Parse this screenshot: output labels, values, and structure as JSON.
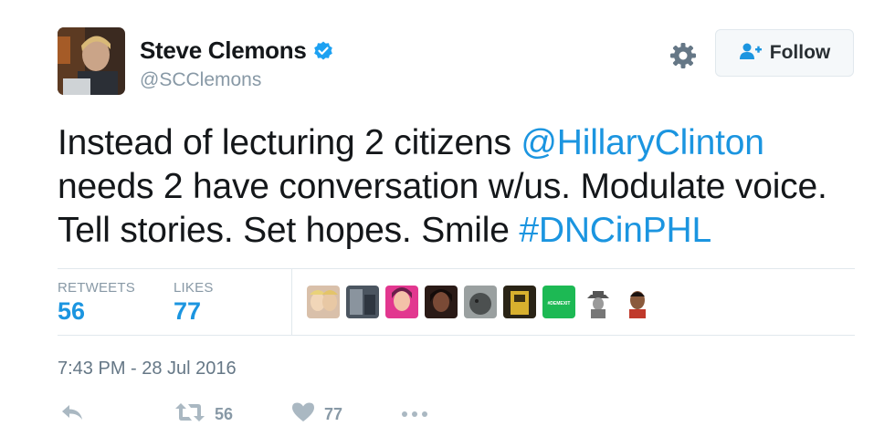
{
  "author": {
    "name": "Steve Clemons",
    "handle": "@SCClemons",
    "verified": true
  },
  "follow_button": {
    "label": "Follow"
  },
  "tweet": {
    "text_before_mention": "Instead of lecturing 2 citizens ",
    "mention": "@HillaryClinton",
    "text_middle": " needs 2 have conversation w/us. Modulate voice. Tell stories. Set hopes. Smile ",
    "hashtag": "#DNCinPHL"
  },
  "stats": {
    "retweets_label": "RETWEETS",
    "retweets_value": "56",
    "likes_label": "LIKES",
    "likes_value": "77"
  },
  "likers": [
    {
      "name": "liker-1",
      "color": "#c9a58a"
    },
    {
      "name": "liker-2",
      "color": "#5a6470"
    },
    {
      "name": "liker-3",
      "color": "#e2378f"
    },
    {
      "name": "liker-4",
      "color": "#3a1f1a"
    },
    {
      "name": "liker-5",
      "color": "#555a5a"
    },
    {
      "name": "liker-6",
      "color": "#b8952a"
    },
    {
      "name": "liker-7",
      "color": "#1db954",
      "text": "#DEMEXIT"
    },
    {
      "name": "liker-8",
      "color": "#d8d8d8"
    },
    {
      "name": "liker-9",
      "color": "#7a4a2e"
    }
  ],
  "timestamp": "7:43 PM - 28 Jul 2016",
  "actions": {
    "retweet_count": "56",
    "like_count": "77"
  },
  "colors": {
    "link": "#1b95e0",
    "muted": "#8899a6",
    "border": "#e1e8ed"
  }
}
